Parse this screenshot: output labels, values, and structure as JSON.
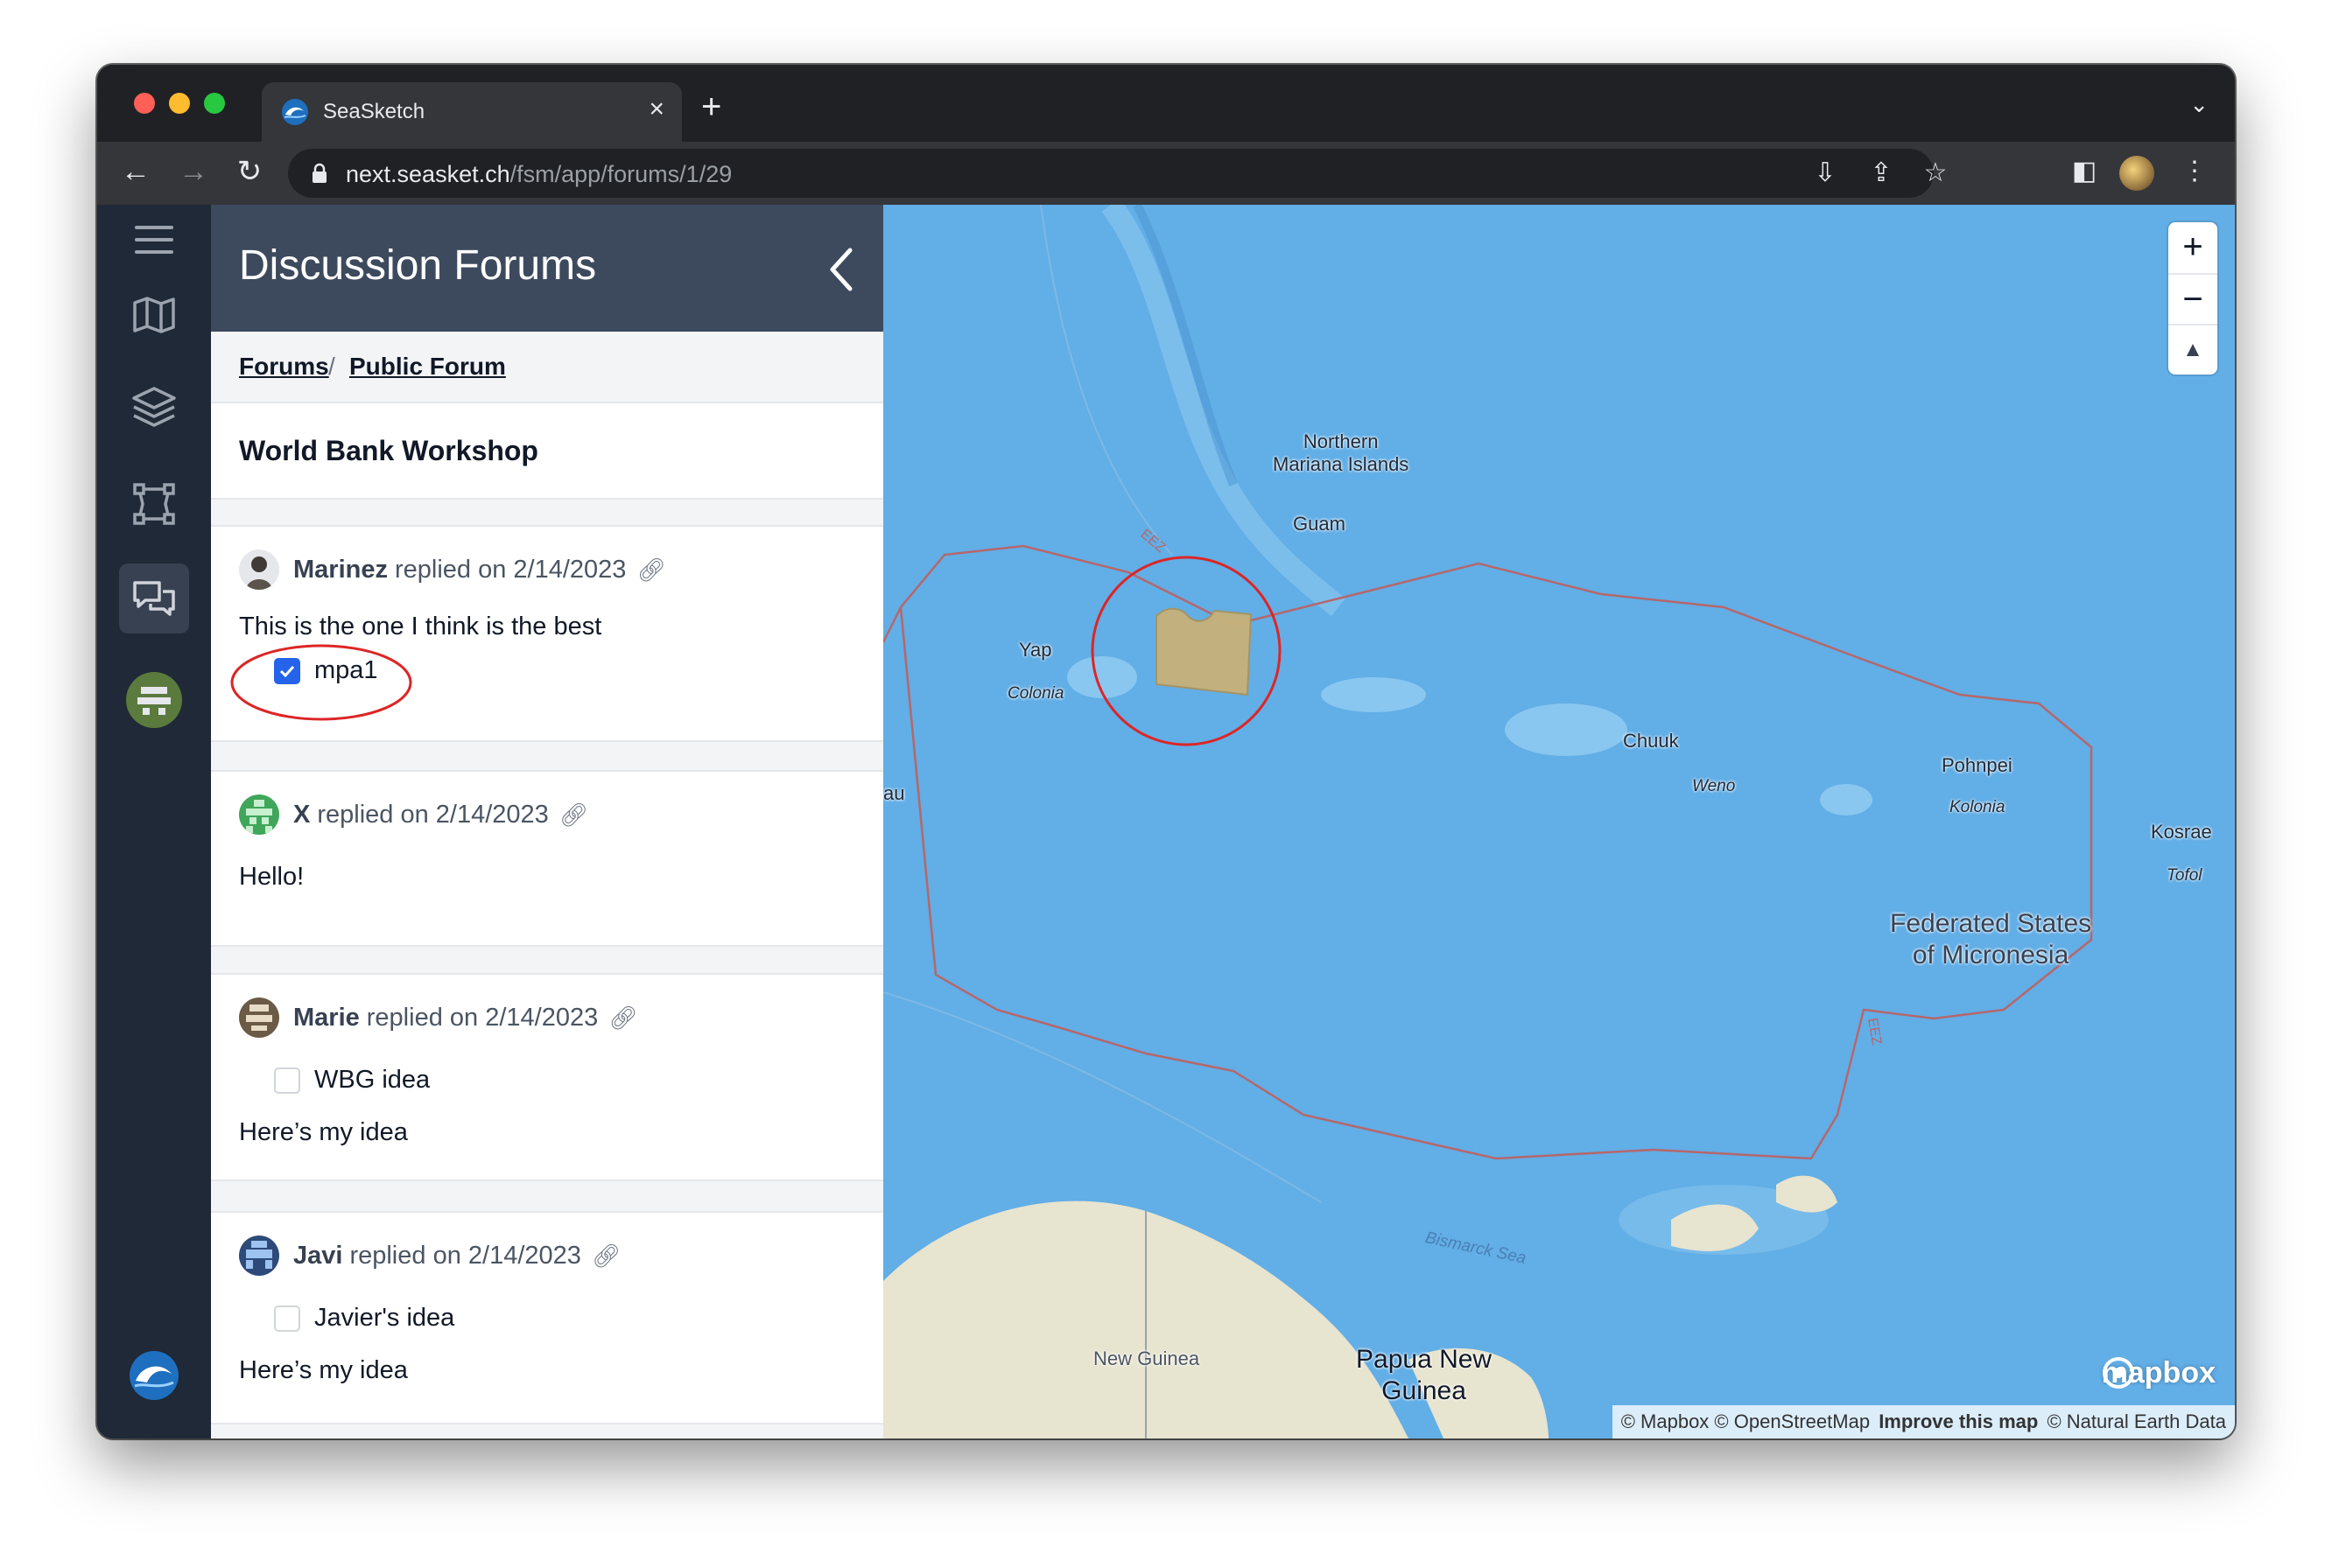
{
  "browser": {
    "tab_title": "SeaSketch",
    "url_host": "next.seasket.ch",
    "url_path": "/fsm/app/forums/1/29"
  },
  "sidebar": {
    "icons": [
      "menu-icon",
      "map-icon",
      "layers-icon",
      "sketch-icon",
      "forum-icon",
      "user-avatar"
    ],
    "active": "forum-icon"
  },
  "panel": {
    "title": "Discussion Forums",
    "breadcrumb": {
      "root": "Forums",
      "separator": "/",
      "forum": "Public Forum"
    },
    "topic_title": "World Bank Workshop",
    "posts": [
      {
        "author": "Marinez",
        "meta": "replied on 2/14/2023",
        "text": "This is the one I think is the best",
        "sketch": "mpa1",
        "sketch_checked": true
      },
      {
        "author": "X",
        "meta": "replied on 2/14/2023",
        "text": "Hello!"
      },
      {
        "author": "Marie",
        "meta": "replied on 2/14/2023",
        "sketch": "WBG idea",
        "sketch_checked": false,
        "text": "Here’s my idea"
      },
      {
        "author": "Javi",
        "meta": "replied on 2/14/2023",
        "sketch": "Javier's idea",
        "sketch_checked": false,
        "text": "Here’s my idea"
      }
    ]
  },
  "map": {
    "labels": {
      "northern_mariana": "Northern\nMariana Islands",
      "guam": "Guam",
      "yap": "Yap",
      "colonia": "Colonia",
      "chuuk": "Chuuk",
      "weno": "Weno",
      "pohnpei": "Pohnpei",
      "kolonia": "Kolonia",
      "kosrae": "Kosrae",
      "tofol": "Tofol",
      "fsm": "Federated States\nof Micronesia",
      "png": "Papua New\nGuinea",
      "new_guinea": "New Guinea",
      "bismarck": "Bismarck Sea",
      "eez": "EEZ",
      "edge_au": "au"
    },
    "zoom_in": "+",
    "zoom_out": "−",
    "compass": "▲",
    "logo": "mapbox",
    "attribution": {
      "part1": "© Mapbox © OpenStreetMap",
      "improve": "Improve this map",
      "part2": "© Natural Earth Data"
    },
    "colors": {
      "ocean": "#62aee6",
      "land": "#e7e4cf",
      "sketch": "#c8b27a",
      "highlight": "#dc2626",
      "eez": "#b5676b"
    }
  }
}
